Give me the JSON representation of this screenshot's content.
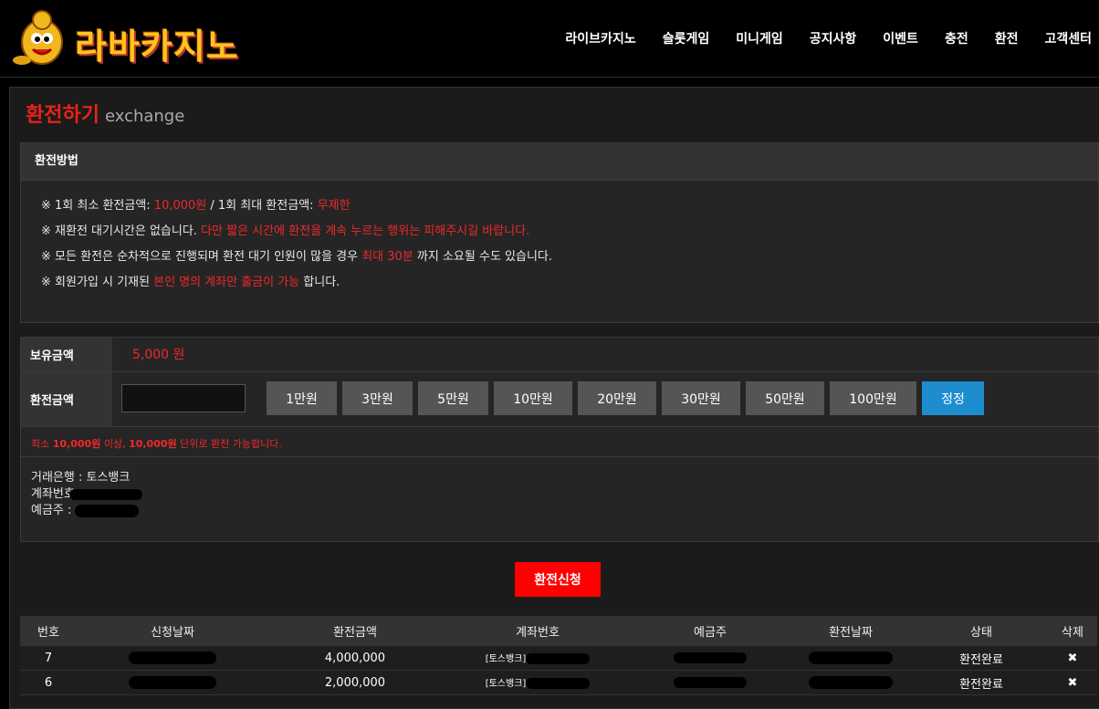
{
  "header": {
    "logo_text": "라바카지노",
    "nav": [
      "라이브카지노",
      "슬롯게임",
      "미니게임",
      "공지사항",
      "이벤트",
      "충전",
      "환전",
      "고객센터"
    ]
  },
  "page": {
    "title_ko": "환전하기",
    "title_en": "exchange"
  },
  "method": {
    "heading": "환전방법",
    "line1": {
      "a": "※ 1회 최소 환전금액: ",
      "b": "10,000원",
      "c": " / 1회 최대 환전금액: ",
      "d": "무제한"
    },
    "line2": {
      "a": "※ 재환전 대기시간은 없습니다. ",
      "b": "다만 짧은 시간에 환전을 계속 누르는 행위는 피해주시길 바랍니다."
    },
    "line3": {
      "a": "※ 모든 환전은 순차적으로 진행되며 환전 대기 인원이 많을 경우 ",
      "b": "최대 30분",
      "c": " 까지 소요될 수도 있습니다."
    },
    "line4": {
      "a": "※ 회원가입 시 기재된 ",
      "b": "본인 명의 계좌만 출금이 가능",
      "c": " 합니다."
    }
  },
  "form": {
    "balance_label": "보유금액",
    "balance_value": "5,000 원",
    "amount_label": "환전금액",
    "amount_value": "",
    "buttons": [
      "1만원",
      "3만원",
      "5만원",
      "10만원",
      "20만원",
      "30만원",
      "50만원",
      "100만원"
    ],
    "reset_label": "정정",
    "note": {
      "a": "최소 ",
      "b": "10,000원",
      "c": " 이상, ",
      "d": "10,000원",
      "e": "  단위로 환전 가능합니다."
    },
    "bank_line": "거래은행 : 토스뱅크",
    "account_label": "계좌번호",
    "holder_label": "예금주 :"
  },
  "submit_label": "환전신청",
  "table": {
    "headers": [
      "번호",
      "신청날짜",
      "환전금액",
      "계좌번호",
      "예금주",
      "환전날짜",
      "상태",
      "삭제"
    ],
    "rows": [
      {
        "no": "7",
        "amount": "4,000,000",
        "bank": "[토스뱅크]",
        "status": "환전완료",
        "delete": "✖"
      },
      {
        "no": "6",
        "amount": "2,000,000",
        "bank": "[토스뱅크]",
        "status": "환전완료",
        "delete": "✖"
      }
    ]
  },
  "colors": {
    "accent_red": "#f0282a",
    "reset_blue": "#1d8dd0",
    "logo_yellow": "#ffc61a"
  }
}
